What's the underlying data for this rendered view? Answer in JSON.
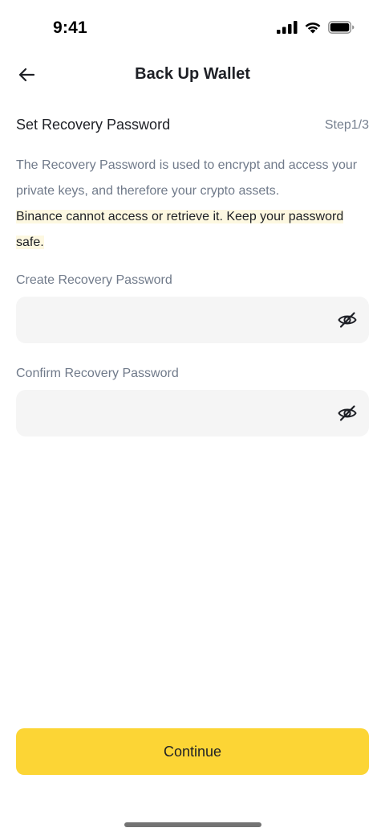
{
  "status_bar": {
    "time": "9:41",
    "icons": [
      "cellular-signal-icon",
      "wifi-icon",
      "battery-icon"
    ]
  },
  "header": {
    "back_icon": "arrow-left-icon",
    "title": "Back Up Wallet"
  },
  "section": {
    "title": "Set Recovery Password",
    "step": "Step1/3"
  },
  "description": {
    "info": "The Recovery Password is used to encrypt and access your private keys, and therefore your crypto assets.",
    "warning": "Binance cannot access or retrieve it. Keep your password safe."
  },
  "form": {
    "create": {
      "label": "Create Recovery Password",
      "value": "",
      "toggle_icon": "eye-slash-icon"
    },
    "confirm": {
      "label": "Confirm Recovery Password",
      "value": "",
      "toggle_icon": "eye-slash-icon"
    }
  },
  "actions": {
    "continue_label": "Continue"
  },
  "colors": {
    "accent": "#fcd535",
    "warning_highlight": "#fdf8e1",
    "field_background": "#f5f5f5",
    "secondary_text": "#707a8a",
    "primary_text": "#1e2026"
  }
}
